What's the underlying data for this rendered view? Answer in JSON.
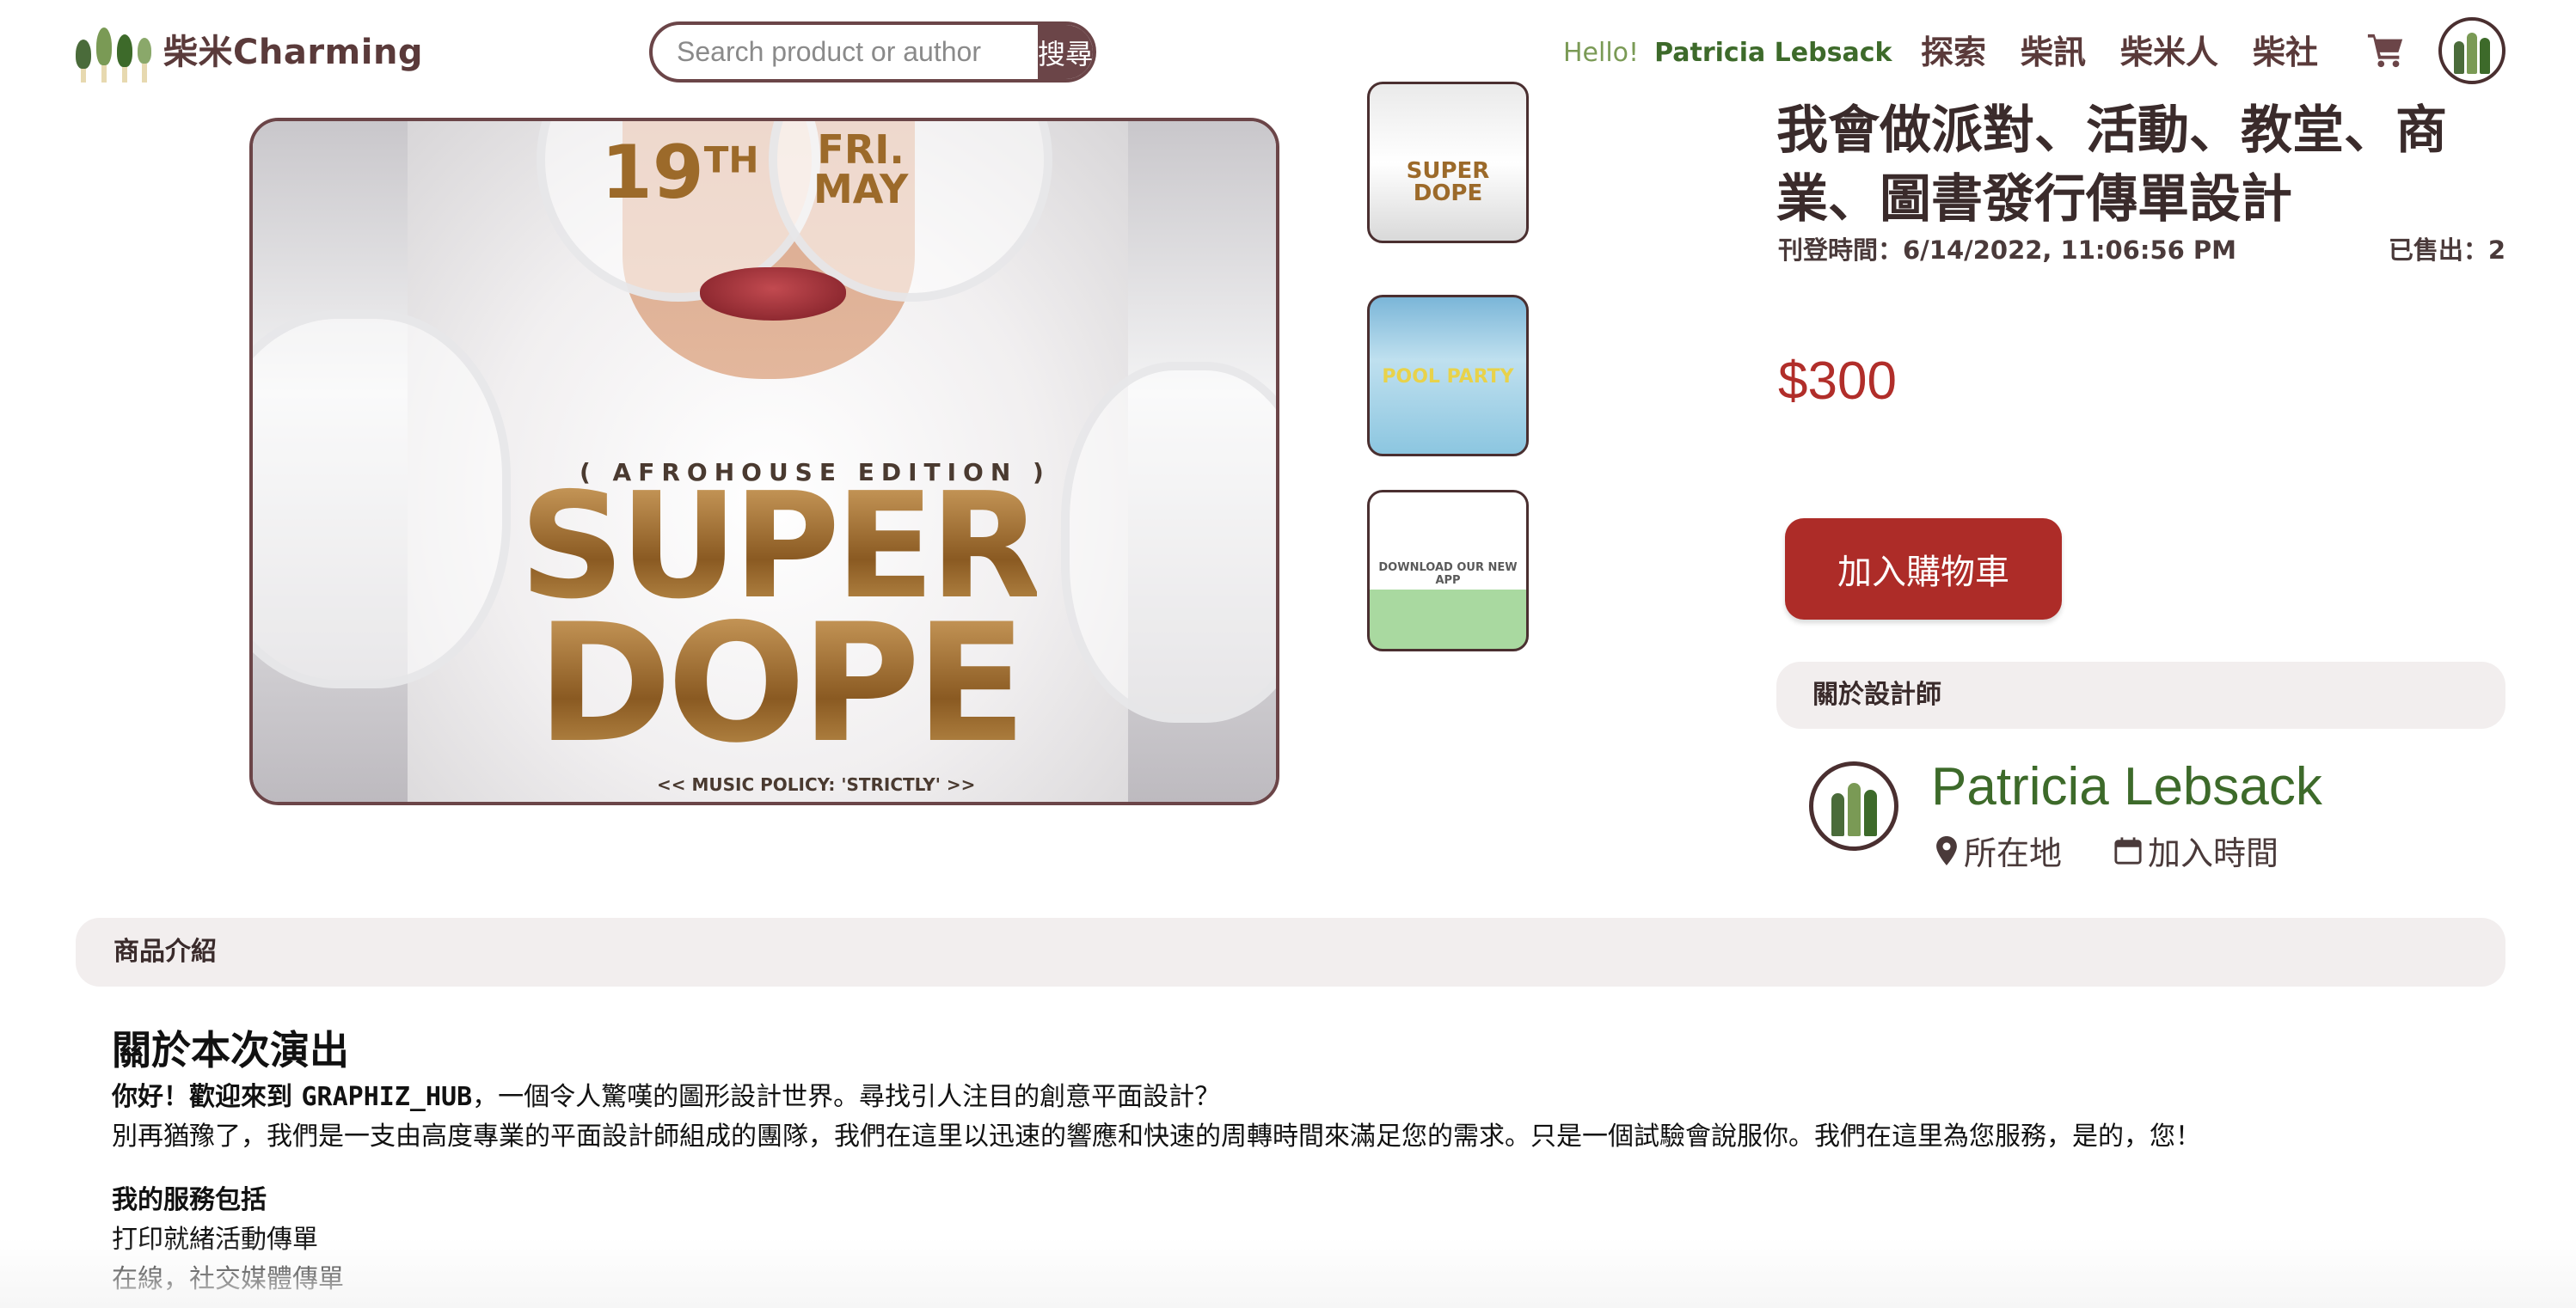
{
  "header": {
    "logo_text": "柴米Charming",
    "search": {
      "placeholder": "Search product or author",
      "button_label": "搜尋"
    },
    "greeting": "Hello!",
    "user_name": "Patricia Lebsack",
    "nav": [
      "探索",
      "柴訊",
      "柴米人",
      "柴社"
    ],
    "icons": {
      "cart": "cart-icon",
      "avatar": "avatar-logo"
    }
  },
  "gallery": {
    "poster": {
      "date_day": "19",
      "date_suffix": "TH",
      "weekday": "FRI.",
      "month": "MAY",
      "edition": "( AFROHOUSE EDITION )",
      "headline_1": "SUPER",
      "headline_2": "DOPE",
      "policy": "<< MUSIC POLICY: 'STRICTLY' >>"
    },
    "thumbnails": [
      {
        "label": "SUPER DOPE"
      },
      {
        "label": "POOL PARTY"
      },
      {
        "label": "DOWNLOAD OUR NEW APP"
      }
    ]
  },
  "product": {
    "title": "我會做派對、活動、教堂、商業、圖書發行傳單設計",
    "posted_label": "刊登時間：6/14/2022, 11:06:56 PM",
    "sold_label": "已售出：2",
    "price": "$300",
    "add_to_cart_label": "加入購物車"
  },
  "designer": {
    "section_label": "關於設計師",
    "name": "Patricia Lebsack",
    "location_label": "所在地",
    "joined_label": "加入時間"
  },
  "description": {
    "section_label": "商品介紹",
    "heading": "關於本次演出",
    "intro_prefix": "你好！歡迎來到 ",
    "intro_brand": "GRAPHIZ_HUB",
    "intro_suffix": "，一個令人驚嘆的圖形設計世界。尋找引人注目的創意平面設計？",
    "paragraph": "別再猶豫了，我們是一支由高度專業的平面設計師組成的團隊，我們在這里以迅速的響應和快速的周轉時間來滿足您的需求。只是一個試驗會說服你。我們在這里為您服務，是的，您！",
    "services_heading": "我的服務包括",
    "services": [
      "打印就緒活動傳單",
      "在線，社交媒體傳單"
    ]
  },
  "colors": {
    "brand": "#6b4548",
    "accent_red": "#ad2c28",
    "green": "#3d6a2a",
    "panel": "#f2eeee"
  }
}
